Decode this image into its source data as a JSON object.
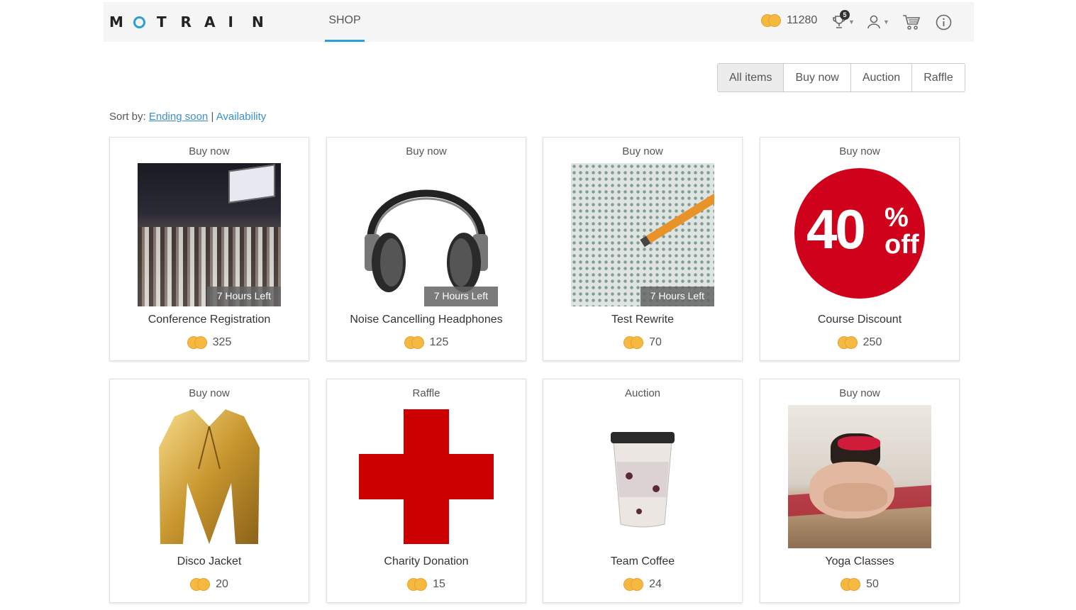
{
  "header": {
    "logo_letters": [
      "M",
      "O",
      "T",
      "R",
      "A",
      "I",
      "N"
    ],
    "shop_tab": "SHOP",
    "balance": "11280",
    "notifications_count": "5",
    "accent_color": "#2a9fd6",
    "coin_color": "#f5b942"
  },
  "filters": {
    "all_items": "All items",
    "buy_now": "Buy now",
    "auction": "Auction",
    "raffle": "Raffle"
  },
  "sort": {
    "label": "Sort by:",
    "ending_soon": "Ending soon",
    "separator": "|",
    "availability": "Availability"
  },
  "items": [
    {
      "type": "Buy now",
      "name": "Conference Registration",
      "price": "325",
      "timer": "7 Hours Left",
      "image": "conference-hall"
    },
    {
      "type": "Buy now",
      "name": "Noise Cancelling Headphones",
      "price": "125",
      "timer": "7 Hours Left",
      "image": "headphones"
    },
    {
      "type": "Buy now",
      "name": "Test Rewrite",
      "price": "70",
      "timer": "7 Hours Left",
      "image": "answer-sheet-pencil"
    },
    {
      "type": "Buy now",
      "name": "Course Discount",
      "price": "250",
      "timer": "",
      "image": "discount-badge",
      "badge_text": "40",
      "badge_pct": "%",
      "badge_off": "off"
    },
    {
      "type": "Buy now",
      "name": "Disco Jacket",
      "price": "20",
      "timer": "",
      "image": "gold-jacket"
    },
    {
      "type": "Raffle",
      "name": "Charity Donation",
      "price": "15",
      "timer": "",
      "image": "red-cross"
    },
    {
      "type": "Auction",
      "name": "Team Coffee",
      "price": "24",
      "timer": "",
      "image": "coffee-cup"
    },
    {
      "type": "Buy now",
      "name": "Yoga Classes",
      "price": "50",
      "timer": "",
      "image": "yoga-stretch"
    }
  ]
}
